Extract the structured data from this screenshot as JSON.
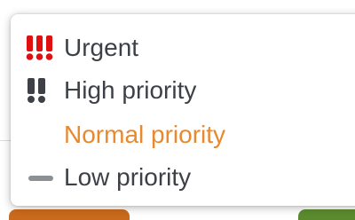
{
  "priority_menu": {
    "items": [
      {
        "label": "Urgent",
        "icon": "triple-exclamation-icon",
        "icon_color": "#e01010",
        "selected": false
      },
      {
        "label": "High priority",
        "icon": "double-exclamation-icon",
        "icon_color": "#3d4147",
        "selected": false
      },
      {
        "label": "Normal priority",
        "icon": "",
        "selected": true
      },
      {
        "label": "Low priority",
        "icon": "dash-icon",
        "icon_color": "#8c8f93",
        "selected": false
      }
    ],
    "selected_color": "#e8892e",
    "text_color": "#3d4147"
  }
}
